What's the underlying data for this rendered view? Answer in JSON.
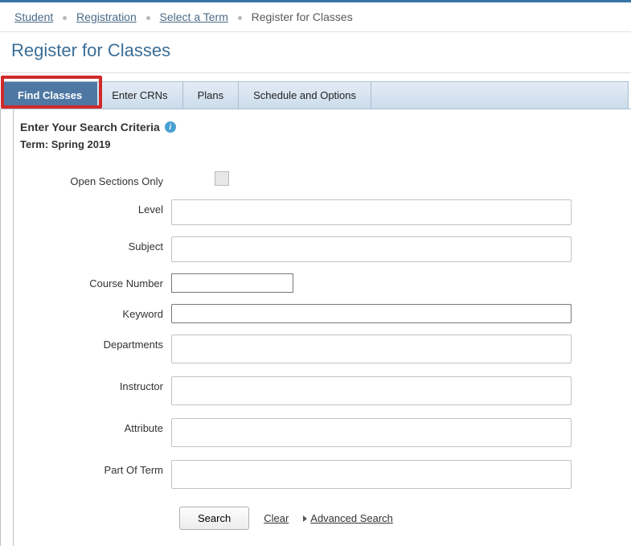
{
  "breadcrumb": {
    "items": [
      {
        "label": "Student",
        "link": true
      },
      {
        "label": "Registration",
        "link": true
      },
      {
        "label": "Select a Term",
        "link": true
      },
      {
        "label": "Register for Classes",
        "link": false
      }
    ]
  },
  "page_title": "Register for Classes",
  "tabs": [
    {
      "label": "Find Classes",
      "active": true
    },
    {
      "label": "Enter CRNs",
      "active": false
    },
    {
      "label": "Plans",
      "active": false
    },
    {
      "label": "Schedule and Options",
      "active": false
    }
  ],
  "search": {
    "heading": "Enter Your Search Criteria",
    "term_prefix": "Term: ",
    "term_value": "Spring 2019",
    "fields": {
      "open_sections": {
        "label": "Open Sections Only",
        "checked": false
      },
      "level": {
        "label": "Level",
        "value": ""
      },
      "subject": {
        "label": "Subject",
        "value": ""
      },
      "course_number": {
        "label": "Course Number",
        "value": ""
      },
      "keyword": {
        "label": "Keyword",
        "value": ""
      },
      "departments": {
        "label": "Departments",
        "value": ""
      },
      "instructor": {
        "label": "Instructor",
        "value": ""
      },
      "attribute": {
        "label": "Attribute",
        "value": ""
      },
      "part_of_term": {
        "label": "Part Of Term",
        "value": ""
      }
    },
    "actions": {
      "search": "Search",
      "clear": "Clear",
      "advanced": "Advanced Search"
    }
  }
}
